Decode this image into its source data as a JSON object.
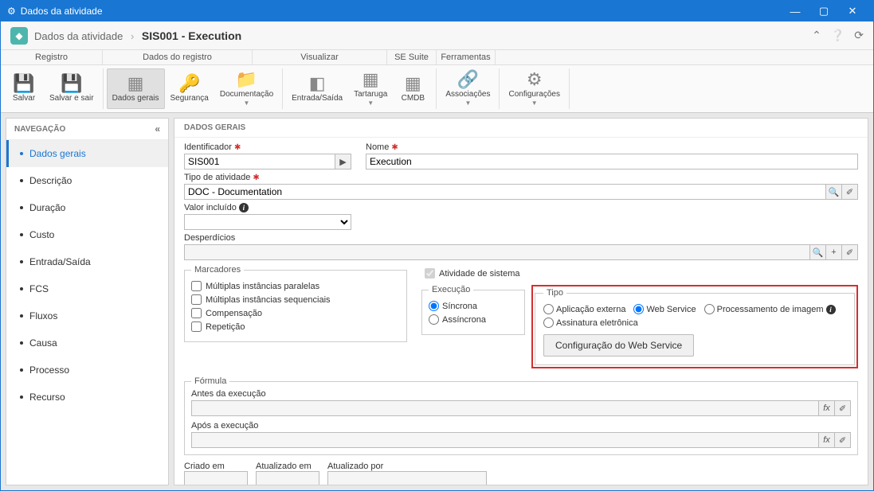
{
  "window": {
    "title": "Dados da atividade"
  },
  "header": {
    "breadcrumb_root": "Dados da atividade",
    "breadcrumb_current": "SIS001 - Execution"
  },
  "ribbon": {
    "tabs": [
      "Registro",
      "Dados do registro",
      "Visualizar",
      "SE Suite",
      "Ferramentas"
    ],
    "buttons": {
      "save": "Salvar",
      "save_exit": "Salvar e sair",
      "general": "Dados gerais",
      "security": "Segurança",
      "documentation": "Documentação",
      "io": "Entrada/Saída",
      "turtle": "Tartaruga",
      "cmdb": "CMDB",
      "associations": "Associações",
      "configs": "Configurações"
    }
  },
  "nav": {
    "title": "NAVEGAÇÃO",
    "items": [
      "Dados gerais",
      "Descrição",
      "Duração",
      "Custo",
      "Entrada/Saída",
      "FCS",
      "Fluxos",
      "Causa",
      "Processo",
      "Recurso"
    ]
  },
  "panel": {
    "title": "DADOS GERAIS",
    "identifier_label": "Identificador",
    "identifier_value": "SIS001",
    "name_label": "Nome",
    "name_value": "Execution",
    "activity_type_label": "Tipo de atividade",
    "activity_type_value": "DOC - Documentation",
    "value_included_label": "Valor incluído",
    "value_included_value": "",
    "wastes_label": "Desperdícios",
    "wastes_value": "",
    "markers": {
      "legend": "Marcadores",
      "parallel": "Múltiplas instâncias paralelas",
      "sequential": "Múltiplas instâncias sequenciais",
      "compensation": "Compensação",
      "repetition": "Repetição"
    },
    "system_activity": "Atividade de sistema",
    "execution": {
      "legend": "Execução",
      "sync": "Síncrona",
      "async": "Assíncrona"
    },
    "type": {
      "legend": "Tipo",
      "external": "Aplicação externa",
      "webservice": "Web Service",
      "img_proc": "Processamento de imagem",
      "esign": "Assinatura eletrônica",
      "config_btn": "Configuração do Web Service"
    },
    "formula": {
      "legend": "Fórmula",
      "before": "Antes da execução",
      "after": "Após a execução"
    },
    "meta": {
      "created": "Criado em",
      "updated": "Atualizado em",
      "updated_by": "Atualizado por"
    }
  }
}
